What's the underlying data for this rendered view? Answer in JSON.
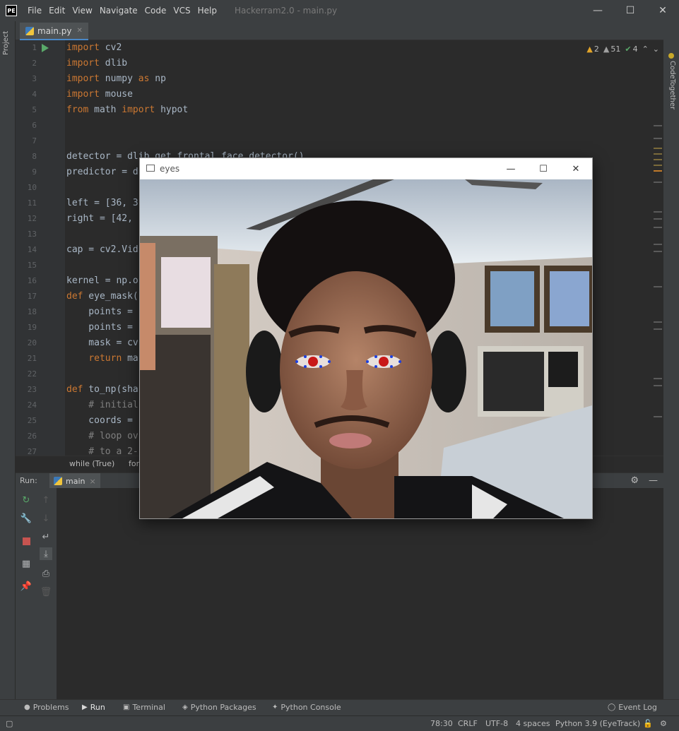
{
  "app": {
    "logo": "PE",
    "title": "Hackerram2.0 - main.py",
    "menu": [
      "File",
      "Edit",
      "View",
      "Navigate",
      "Code",
      "VCS",
      "Help"
    ],
    "controls": {
      "minimize": "—",
      "maximize": "☐",
      "close": "✕"
    }
  },
  "side": {
    "left_label": "Project",
    "right_label": "CodeTogether"
  },
  "editor": {
    "tab": "main.py",
    "inspections": {
      "warnings": "2",
      "weak_warnings": "51",
      "ok": "4"
    },
    "lines": [
      {
        "n": "1",
        "tokens": [
          {
            "t": "import",
            "k": 1
          },
          {
            "t": " cv2"
          }
        ]
      },
      {
        "n": "2",
        "tokens": [
          {
            "t": "import",
            "k": 1
          },
          {
            "t": " dlib"
          }
        ]
      },
      {
        "n": "3",
        "tokens": [
          {
            "t": "import",
            "k": 1
          },
          {
            "t": " numpy "
          },
          {
            "t": "as",
            "k": 1
          },
          {
            "t": " np"
          }
        ]
      },
      {
        "n": "4",
        "tokens": [
          {
            "t": "import",
            "k": 1
          },
          {
            "t": " mouse"
          }
        ]
      },
      {
        "n": "5",
        "tokens": [
          {
            "t": "from",
            "k": 1
          },
          {
            "t": " math "
          },
          {
            "t": "import",
            "k": 1
          },
          {
            "t": " hypot"
          }
        ]
      },
      {
        "n": "6",
        "tokens": []
      },
      {
        "n": "7",
        "tokens": []
      },
      {
        "n": "8",
        "tokens": [
          {
            "t": "detector = dlib.get_frontal_face_detector()"
          }
        ]
      },
      {
        "n": "9",
        "tokens": [
          {
            "t": "predictor = d"
          }
        ]
      },
      {
        "n": "10",
        "tokens": []
      },
      {
        "n": "11",
        "tokens": [
          {
            "t": "left = [36, 3"
          }
        ]
      },
      {
        "n": "12",
        "tokens": [
          {
            "t": "right = [42,"
          }
        ]
      },
      {
        "n": "13",
        "tokens": []
      },
      {
        "n": "14",
        "tokens": [
          {
            "t": "cap = cv2.Vid"
          }
        ]
      },
      {
        "n": "15",
        "tokens": []
      },
      {
        "n": "16",
        "tokens": [
          {
            "t": "kernel = np.o"
          }
        ]
      },
      {
        "n": "17",
        "tokens": [
          {
            "t": "def",
            "k": 1
          },
          {
            "t": " eye_mask("
          }
        ]
      },
      {
        "n": "18",
        "tokens": [
          {
            "t": "    points = "
          }
        ]
      },
      {
        "n": "19",
        "tokens": [
          {
            "t": "    points = "
          }
        ]
      },
      {
        "n": "20",
        "tokens": [
          {
            "t": "    mask = cv"
          }
        ]
      },
      {
        "n": "21",
        "tokens": [
          {
            "t": "    "
          },
          {
            "t": "return",
            "k": 1
          },
          {
            "t": " ma"
          }
        ]
      },
      {
        "n": "22",
        "tokens": []
      },
      {
        "n": "23",
        "tokens": [
          {
            "t": "def",
            "k": 1
          },
          {
            "t": " to_np(sha"
          }
        ]
      },
      {
        "n": "24",
        "tokens": [
          {
            "t": "    # initial",
            "c": 1
          }
        ]
      },
      {
        "n": "25",
        "tokens": [
          {
            "t": "    coords = "
          }
        ]
      },
      {
        "n": "26",
        "tokens": [
          {
            "t": "    # loop ov",
            "c": 1
          }
        ]
      },
      {
        "n": "27",
        "tokens": [
          {
            "t": "    # to a 2-",
            "c": 1
          }
        ]
      }
    ],
    "breadcrumbs": [
      "while (True)",
      "for"
    ]
  },
  "run": {
    "label": "Run:",
    "tab": "main",
    "close": "×",
    "settings_icon": "⚙",
    "hide_icon": "—"
  },
  "bottom_tabs": {
    "problems": "Problems",
    "run": "Run",
    "terminal": "Terminal",
    "python_packages": "Python Packages",
    "python_console": "Python Console",
    "event_log": "Event Log"
  },
  "status": {
    "position": "78:30",
    "line_sep": "CRLF",
    "encoding": "UTF-8",
    "indent": "4 spaces",
    "interpreter": "Python 3.9 (EyeTrack)"
  },
  "camera_window": {
    "title": "eyes",
    "controls": {
      "minimize": "—",
      "maximize": "☐",
      "close": "✕"
    }
  },
  "colors": {
    "ide_bg": "#2b2b2b",
    "panel": "#3c3f41",
    "keyword": "#cc7832",
    "text": "#a9b7c6",
    "run_green": "#59a869",
    "stop_red": "#c75450"
  }
}
